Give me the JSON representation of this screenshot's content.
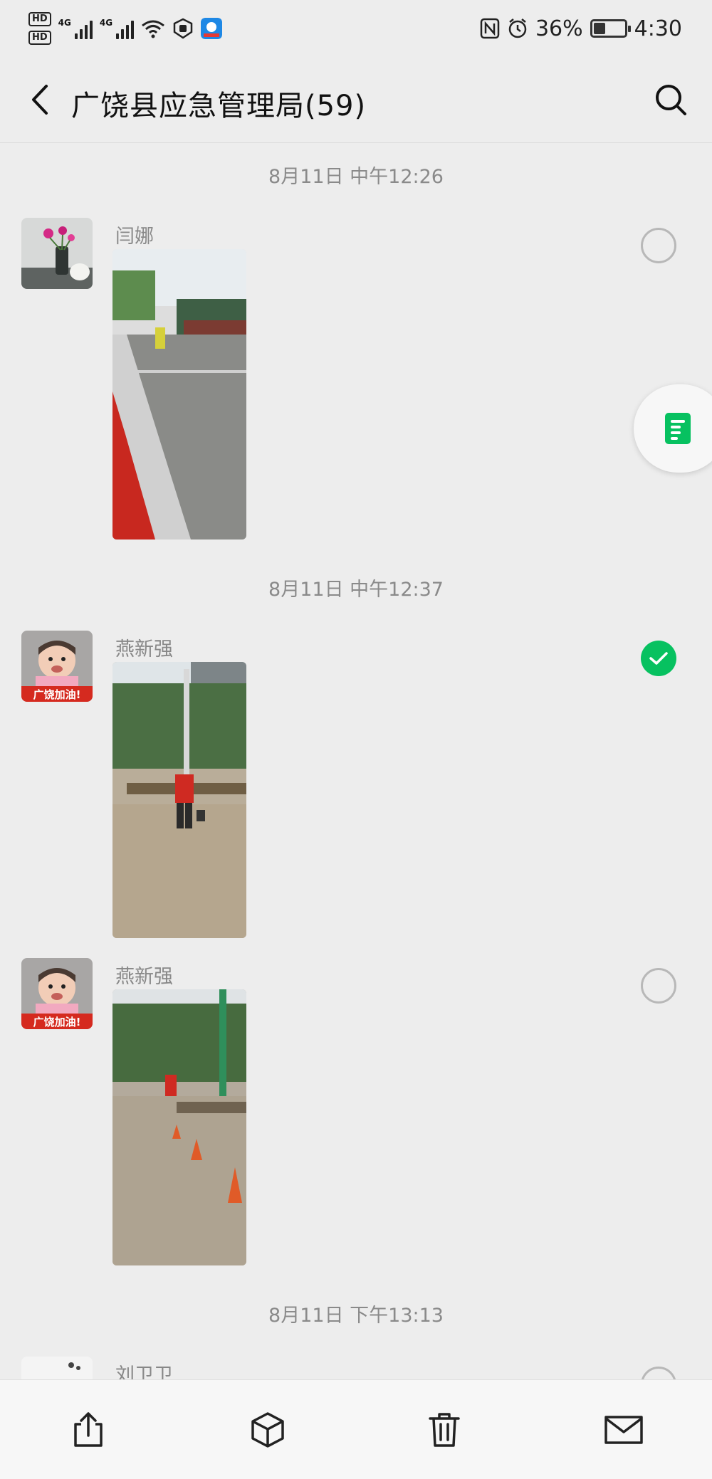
{
  "status_bar": {
    "hd1": "HD",
    "hd2": "HD",
    "net1": "4G",
    "net2": "4G",
    "battery_percent": "36%",
    "battery_level": 0.36,
    "time": "4:30"
  },
  "header": {
    "title": "广饶县应急管理局(59)"
  },
  "messages": [
    {
      "timestamp": "8月11日 中午12:26",
      "sender": "闫娜",
      "selected": false
    },
    {
      "timestamp": "8月11日 中午12:37",
      "sender": "燕新强",
      "selected": true
    },
    {
      "timestamp": "",
      "sender": "燕新强",
      "selected": false
    },
    {
      "timestamp": "8月11日 下午13:13",
      "sender": "刘卫卫",
      "selected": false
    }
  ],
  "avatar_badge_text": "广饶加油!",
  "bottom_bar": {
    "icons": [
      "share-icon",
      "cube-icon",
      "trash-icon",
      "mail-icon"
    ]
  },
  "colors": {
    "background": "#ededed",
    "accent_green": "#07c160",
    "timestamp_gray": "#8a8a8a"
  }
}
